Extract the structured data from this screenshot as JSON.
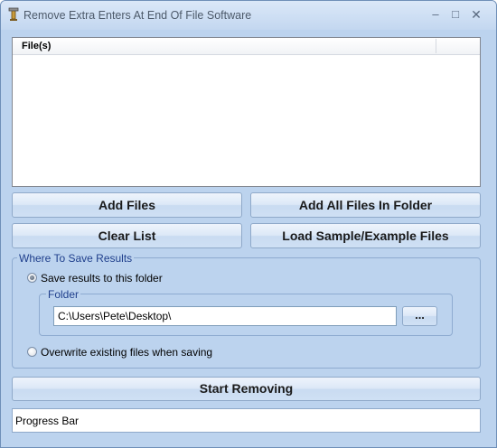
{
  "window": {
    "title": "Remove Extra Enters At End Of File Software",
    "minimize_glyph": "–",
    "maximize_glyph": "□",
    "close_glyph": "✕"
  },
  "file_list": {
    "column_header": "File(s)",
    "rows": []
  },
  "buttons": {
    "add_files": "Add Files",
    "add_all_files_in_folder": "Add All Files In Folder",
    "clear_list": "Clear List",
    "load_sample": "Load Sample/Example Files",
    "start": "Start Removing",
    "browse": "..."
  },
  "save_group": {
    "legend": "Where To Save Results",
    "option_save_to_folder": "Save results to this folder",
    "option_overwrite": "Overwrite existing files when saving",
    "selected_option": "save_to_folder",
    "folder_legend": "Folder",
    "folder_path": "C:\\Users\\Pete\\Desktop\\"
  },
  "progress": {
    "label": "Progress Bar"
  },
  "icons": {
    "app_icon": "gear-tool-icon"
  }
}
